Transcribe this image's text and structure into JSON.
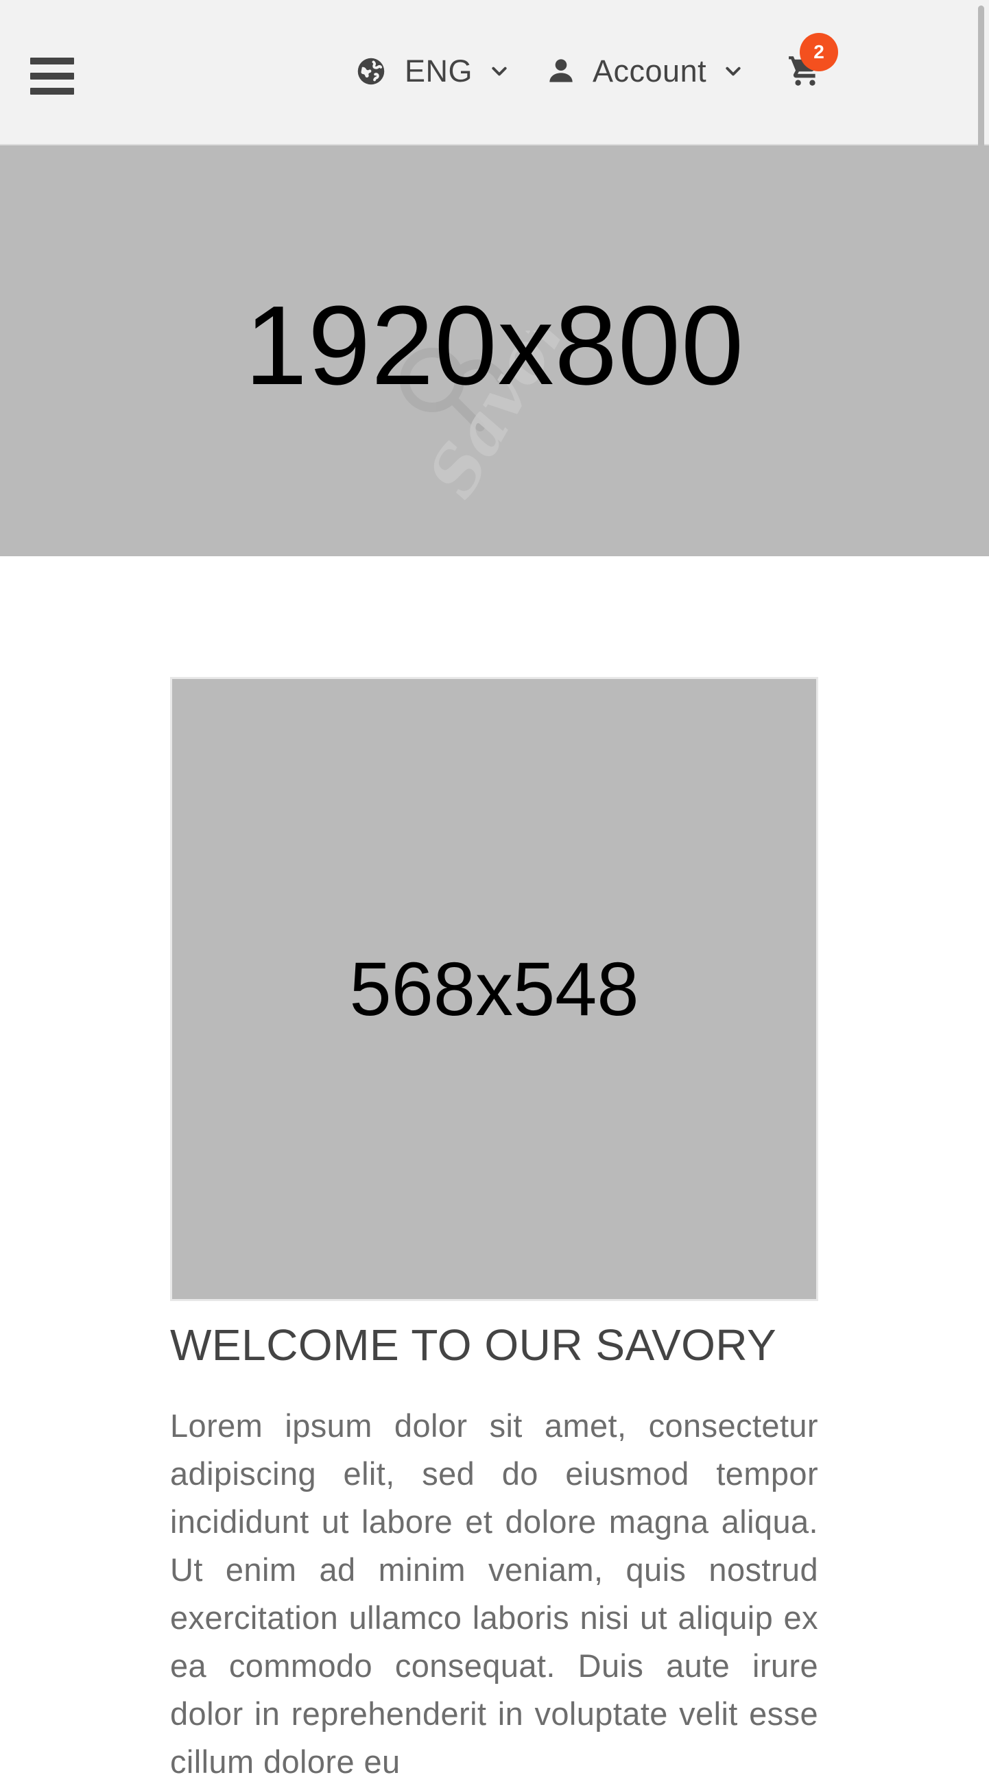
{
  "header": {
    "language": {
      "label": "ENG",
      "icon": "globe-icon"
    },
    "account": {
      "label": "Account",
      "icon": "user-icon"
    },
    "cart": {
      "icon": "cart-icon",
      "count": "2",
      "badge_color": "#f4501e"
    },
    "menu_icon": "hamburger-menu-icon"
  },
  "hero": {
    "placeholder_text": "1920x800",
    "background": "#bababa"
  },
  "welcome": {
    "image_placeholder_text": "568x548",
    "title": "WELCOME TO OUR SAVORY",
    "body": "Lorem ipsum dolor sit amet, consectetur adipiscing elit, sed do eiusmod tempor incididunt ut labore et dolore magna aliqua. Ut enim ad minim veniam, quis nostrud exercitation ullamco laboris nisi ut aliquip ex ea commodo consequat. Duis aute irure dolor in reprehenderit in voluptate velit esse cillum dolore eu"
  }
}
